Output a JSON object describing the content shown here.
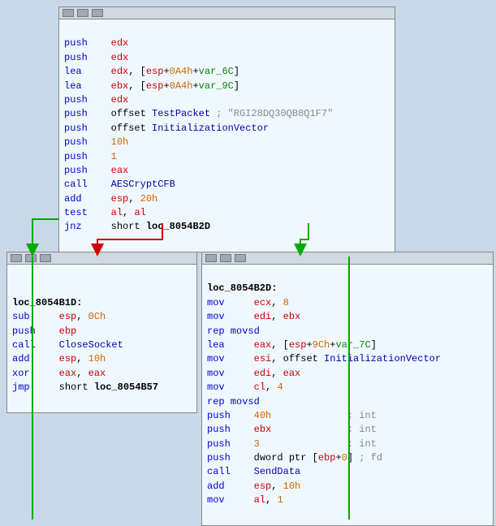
{
  "top_box": {
    "title_icons": [
      "graph-icon",
      "minus-icon",
      "close-icon"
    ],
    "lines": [
      {
        "indent": "push",
        "op": "edx",
        "comment": ""
      },
      {
        "indent": "push",
        "op": "edx",
        "comment": ""
      },
      {
        "indent": "lea",
        "op": "edx, [esp+0A4h+var_6C]",
        "comment": ""
      },
      {
        "indent": "lea",
        "op": "ebx, [esp+0A4h+var_9C]",
        "comment": ""
      },
      {
        "indent": "push",
        "op": "edx",
        "comment": ""
      },
      {
        "indent": "push",
        "op": "offset TestPacket ; \"RGI28DQ30QB8Q1F7\"",
        "comment": ""
      },
      {
        "indent": "push",
        "op": "offset InitializationVector",
        "comment": ""
      },
      {
        "indent": "push",
        "op": "10h",
        "comment": ""
      },
      {
        "indent": "push",
        "op": "1",
        "comment": ""
      },
      {
        "indent": "push",
        "op": "eax",
        "comment": ""
      },
      {
        "indent": "call",
        "op": "AESCryptCFB",
        "comment": ""
      },
      {
        "indent": "add",
        "op": "esp, 20h",
        "comment": ""
      },
      {
        "indent": "test",
        "op": "al, al",
        "comment": ""
      },
      {
        "indent": "jnz",
        "op": "short loc_8054B2D",
        "comment": ""
      }
    ]
  },
  "bottom_left_box": {
    "title_icons": [
      "graph-icon",
      "minus-icon",
      "close-icon"
    ],
    "lines": [
      {
        "text": ""
      },
      {
        "text": "loc_8054B1D:"
      },
      {
        "text": "sub     esp, 0Ch"
      },
      {
        "text": "push    ebp"
      },
      {
        "text": "call    CloseSocket"
      },
      {
        "text": "add     esp, 10h"
      },
      {
        "text": "xor     eax, eax"
      },
      {
        "text": "jmp     short loc_8054B57"
      }
    ]
  },
  "bottom_right_box": {
    "title_icons": [
      "graph-icon",
      "minus-icon",
      "close-icon"
    ],
    "lines": [
      {
        "text": "loc_8054B2D:"
      },
      {
        "text": "mov     ecx, 8"
      },
      {
        "text": "mov     edi, ebx"
      },
      {
        "text": "rep movsd"
      },
      {
        "text": "lea     eax, [esp+9Ch+var_7C]"
      },
      {
        "text": "mov     esi, offset InitializationVector"
      },
      {
        "text": "mov     edi, eax"
      },
      {
        "text": "mov     cl, 4"
      },
      {
        "text": "rep movsd"
      },
      {
        "text": "push    40h             ; int"
      },
      {
        "text": "push    ebx             ; int"
      },
      {
        "text": "push    3               ; int"
      },
      {
        "text": "push    dword ptr [ebp+0] ; fd"
      },
      {
        "text": "call    SendData"
      },
      {
        "text": "add     esp, 10h"
      },
      {
        "text": "mov     al, 1"
      }
    ]
  }
}
